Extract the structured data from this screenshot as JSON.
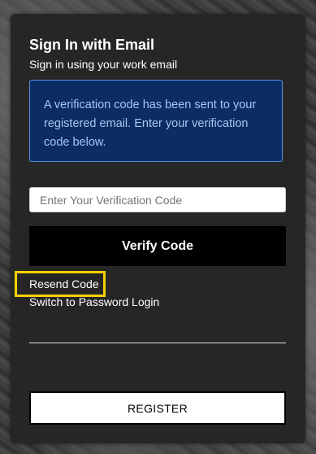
{
  "signin": {
    "title": "Sign In with Email",
    "subtitle": "Sign in using your work email",
    "notice": "A verification code has been sent to your registered email. Enter your verification code below.",
    "code_placeholder": "Enter Your Verification Code",
    "code_value": "",
    "verify_label": "Verify Code",
    "resend_label": "Resend Code",
    "switch_label": "Switch to Password Login",
    "register_label": "REGISTER"
  },
  "colors": {
    "card_bg": "#262626",
    "notice_bg": "#0b2d63",
    "notice_border": "#5a8de0",
    "highlight": "#f5d300"
  }
}
